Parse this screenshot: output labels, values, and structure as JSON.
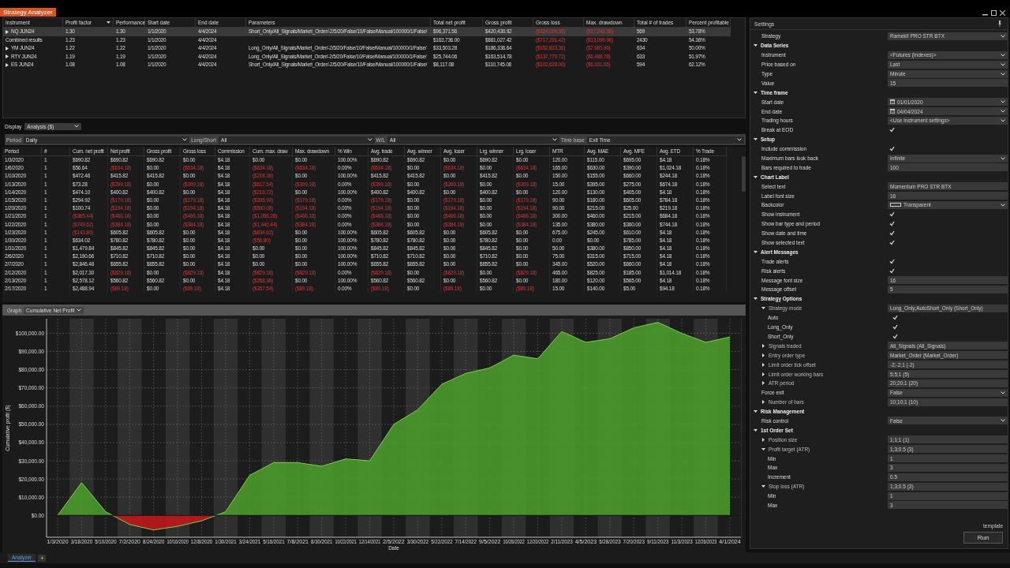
{
  "window": {
    "title": "Strategy Analyzer"
  },
  "summary": {
    "columns": [
      {
        "label": "Instrument"
      },
      {
        "label": "Profit factor",
        "sorted": true
      },
      {
        "label": "Performance"
      },
      {
        "label": "Start date"
      },
      {
        "label": "End date"
      },
      {
        "label": "Parameters"
      },
      {
        "label": "Total net profit"
      },
      {
        "label": "Gross profit"
      },
      {
        "label": "Gross loss"
      },
      {
        "label": "Max. drawdown"
      },
      {
        "label": "Total # of trades"
      },
      {
        "label": "Percent profitable"
      }
    ],
    "rows": [
      {
        "kind": "instrument",
        "selected": true,
        "cells": [
          "NQ JUN24",
          "1.30",
          "1.30",
          "1/1/2020",
          "4/4/2024",
          "Short_Only/All_Signals/Market_Order/-2/5/20/False/10/False/Manual/100000/1/False/",
          "$96,371.56",
          "$420,430.92",
          "($324,059.36)",
          "($17,242.36)",
          "569",
          "53.78%"
        ]
      },
      {
        "kind": "combined",
        "selected": false,
        "cells": [
          "Combined results",
          "1.23",
          "1.23",
          "1/1/2020",
          "4/4/2024",
          "",
          "$163,736.00",
          "$881,027.42",
          "($717,291.42)",
          "($13,096.96)",
          "2430",
          "54.36%"
        ]
      },
      {
        "kind": "instrument",
        "selected": false,
        "cells": [
          "YM JUN24",
          "1.22",
          "1.22",
          "1/1/2020",
          "4/4/2024",
          "Long_Only/All_Signals/Market_Order/-2/5/20/False/10/False/Manual/100000/1/False/",
          "$33,503.28",
          "$186,336.64",
          "($152,833.36)",
          "($7,665.96)",
          "634",
          "50.00%"
        ]
      },
      {
        "kind": "instrument",
        "selected": false,
        "cells": [
          "RTY JUN24",
          "1.19",
          "1.19",
          "1/1/2020",
          "4/4/2024",
          "Long_Only/All_Signals/Market_Order/-2/5/20/False/10/False/Manual/100000/1/False/",
          "$25,744.06",
          "$163,514.78",
          "($137,770.72)",
          "($6,488.78)",
          "633",
          "51.97%"
        ]
      },
      {
        "kind": "instrument",
        "selected": false,
        "cells": [
          "ES JUN24",
          "1.08",
          "1.08",
          "1/1/2020",
          "4/4/2024",
          "Short_Only/All_Signals/Market_Order/-2/5/20/False/10/False/Manual/100000/1/False/",
          "$8,117.08",
          "$110,745.08",
          "($102,628.00)",
          "($6,931.06)",
          "594",
          "62.12%"
        ]
      }
    ]
  },
  "display": {
    "label": "Display",
    "value": "Analysis ($)"
  },
  "filters": [
    {
      "label": "Period",
      "value": "Daily"
    },
    {
      "label": "Long/Short",
      "value": "All"
    },
    {
      "label": "W/L",
      "value": "All"
    },
    {
      "label": "Time base",
      "value": "Exit Time"
    }
  ],
  "periods": {
    "columns": [
      "Period",
      "#",
      "Cum. net profit",
      "Net profit",
      "Gross profit",
      "Gross loss",
      "Commission",
      "Cum. max. draw",
      "Max. drawdown",
      "% Win",
      "Avg. trade",
      "Avg. winner",
      "Avg. loser",
      "Lrg. winner",
      "Lrg. loser",
      "MTR",
      "Avg. MAE",
      "Avg. MFE",
      "Avg. ETD",
      "% Trade"
    ],
    "rows": [
      {
        "kind": "win",
        "cum_negative": false,
        "drawdown_negative": false,
        "cells": [
          "1/3/2020",
          "1",
          "$690.82",
          "$690.82",
          "$690.82",
          "$0.00",
          "$4.18",
          "$0.00",
          "$0.00",
          "100.00%",
          "$690.82",
          "$690.82",
          "$0.00",
          "$690.82",
          "$0.00",
          "120.00",
          "$115.00",
          "$695.00",
          "$4.18",
          "0.18%"
        ]
      },
      {
        "kind": "loss",
        "cum_negative": false,
        "drawdown_negative": true,
        "cells": [
          "1/6/2020",
          "1",
          "$56.64",
          "($634.18)",
          "$0.00",
          "($634.18)",
          "$4.18",
          "($634.18)",
          "($634.18)",
          "0.00%",
          "($634.18)",
          "$0.00",
          "($634.18)",
          "$0.00",
          "($634.18)",
          "165.00",
          "$630.00",
          "$390.00",
          "$1,024.18",
          "0.18%"
        ]
      },
      {
        "kind": "win",
        "cum_negative": false,
        "drawdown_negative": true,
        "cells": [
          "1/10/2020",
          "1",
          "$472.46",
          "$415.82",
          "$415.82",
          "$0.00",
          "$4.18",
          "($218.36)",
          "$0.00",
          "100.00%",
          "$415.82",
          "$415.82",
          "$0.00",
          "$415.82",
          "$0.00",
          "150.00",
          "$155.00",
          "$660.00",
          "$244.18",
          "0.18%"
        ]
      },
      {
        "kind": "loss",
        "cum_negative": false,
        "drawdown_negative": true,
        "cells": [
          "1/13/2020",
          "1",
          "$73.28",
          "($399.18)",
          "$0.00",
          "($399.18)",
          "$4.18",
          "($617.54)",
          "($399.18)",
          "0.00%",
          "($399.18)",
          "$0.00",
          "($399.18)",
          "$0.00",
          "($399.18)",
          "15.00",
          "$395.00",
          "$275.00",
          "$674.18",
          "0.18%"
        ]
      },
      {
        "kind": "win",
        "cum_negative": false,
        "drawdown_negative": true,
        "cells": [
          "1/14/2020",
          "1",
          "$474.10",
          "$400.82",
          "$400.82",
          "$0.00",
          "$4.18",
          "($216.72)",
          "$0.00",
          "100.00%",
          "$400.82",
          "$400.82",
          "$0.00",
          "$400.82",
          "$0.00",
          "120.00",
          "$130.00",
          "$405.00",
          "$4.18",
          "0.18%"
        ]
      },
      {
        "kind": "loss",
        "cum_negative": false,
        "drawdown_negative": true,
        "cells": [
          "1/15/2020",
          "1",
          "$294.92",
          "($179.18)",
          "$0.00",
          "($179.18)",
          "$4.18",
          "($395.90)",
          "($179.18)",
          "0.00%",
          "($179.18)",
          "$0.00",
          "($179.18)",
          "$0.00",
          "($179.18)",
          "90.00",
          "$180.00",
          "$605.00",
          "$784.18",
          "0.18%"
        ]
      },
      {
        "kind": "loss",
        "cum_negative": false,
        "drawdown_negative": true,
        "cells": [
          "1/20/2020",
          "1",
          "$100.74",
          "($194.18)",
          "$0.00",
          "($194.18)",
          "$4.18",
          "($590.08)",
          "($194.18)",
          "0.00%",
          "($194.18)",
          "$0.00",
          "($194.18)",
          "$0.00",
          "($194.18)",
          "90.00",
          "$215.00",
          "$25.00",
          "$219.18",
          "0.18%"
        ]
      },
      {
        "kind": "loss",
        "cum_negative": true,
        "drawdown_negative": true,
        "cells": [
          "1/21/2020",
          "1",
          "($365.44)",
          "($466.18)",
          "$0.00",
          "($466.18)",
          "$4.18",
          "($1,056.26)",
          "($466.18)",
          "0.00%",
          "($466.18)",
          "$0.00",
          "($466.18)",
          "$0.00",
          "($466.18)",
          "300.00",
          "$460.00",
          "$215.00",
          "$684.18",
          "0.18%"
        ]
      },
      {
        "kind": "loss",
        "cum_negative": true,
        "drawdown_negative": true,
        "cells": [
          "1/22/2020",
          "1",
          "($749.62)",
          "($384.18)",
          "$0.00",
          "($384.18)",
          "$4.18",
          "($1,440.44)",
          "($384.18)",
          "0.00%",
          "($384.18)",
          "$0.00",
          "($384.18)",
          "$0.00",
          "($384.18)",
          "135.00",
          "$380.00",
          "$360.00",
          "$744.18",
          "0.18%"
        ]
      },
      {
        "kind": "win",
        "cum_negative": true,
        "drawdown_negative": true,
        "cells": [
          "1/23/2020",
          "1",
          "($143.80)",
          "$605.82",
          "$605.82",
          "$0.00",
          "$4.18",
          "($834.62)",
          "$0.00",
          "100.00%",
          "$605.82",
          "$605.82",
          "$0.00",
          "$605.82",
          "$0.00",
          "675.00",
          "$245.00",
          "$610.00",
          "$4.18",
          "0.18%"
        ]
      },
      {
        "kind": "win",
        "cum_negative": false,
        "drawdown_negative": true,
        "cells": [
          "1/30/2020",
          "1",
          "$634.02",
          "$780.82",
          "$780.82",
          "$0.00",
          "$4.18",
          "($56.80)",
          "$0.00",
          "100.00%",
          "$780.82",
          "$780.82",
          "$0.00",
          "$780.82",
          "$0.00",
          "0.00",
          "$0.00",
          "$785.00",
          "$4.18",
          "0.18%"
        ]
      },
      {
        "kind": "win",
        "cum_negative": false,
        "drawdown_negative": false,
        "cells": [
          "1/31/2020",
          "1",
          "$1,479.84",
          "$845.82",
          "$845.82",
          "$0.00",
          "$4.18",
          "$0.00",
          "$0.00",
          "100.00%",
          "$845.82",
          "$845.82",
          "$0.00",
          "$845.82",
          "$0.00",
          "50.00",
          "$380.00",
          "$850.00",
          "$4.18",
          "0.18%"
        ]
      },
      {
        "kind": "win",
        "cum_negative": false,
        "drawdown_negative": false,
        "cells": [
          "2/6/2020",
          "1",
          "$2,190.66",
          "$710.82",
          "$710.82",
          "$0.00",
          "$4.18",
          "$0.00",
          "$0.00",
          "100.00%",
          "$710.82",
          "$710.82",
          "$0.00",
          "$710.82",
          "$0.00",
          "75.00",
          "$315.00",
          "$715.00",
          "$4.18",
          "0.18%"
        ]
      },
      {
        "kind": "win",
        "cum_negative": false,
        "drawdown_negative": false,
        "cells": [
          "2/7/2020",
          "1",
          "$2,846.48",
          "$655.82",
          "$655.82",
          "$0.00",
          "$4.18",
          "$0.00",
          "$0.00",
          "100.00%",
          "$655.82",
          "$655.82",
          "$0.00",
          "$655.82",
          "$0.00",
          "345.00",
          "$520.00",
          "$660.00",
          "$4.18",
          "0.18%"
        ]
      },
      {
        "kind": "loss",
        "cum_negative": false,
        "drawdown_negative": true,
        "cells": [
          "2/12/2020",
          "1",
          "$2,017.30",
          "($829.18)",
          "$0.00",
          "($829.18)",
          "$4.18",
          "($829.18)",
          "($829.18)",
          "0.00%",
          "($829.18)",
          "$0.00",
          "($829.18)",
          "$0.00",
          "($829.18)",
          "465.00",
          "$825.00",
          "$185.00",
          "$1,014.18",
          "0.18%"
        ]
      },
      {
        "kind": "win",
        "cum_negative": false,
        "drawdown_negative": true,
        "cells": [
          "2/13/2020",
          "1",
          "$2,578.12",
          "$560.82",
          "$560.82",
          "$0.00",
          "$4.18",
          "($268.36)",
          "$0.00",
          "100.00%",
          "$560.82",
          "$560.82",
          "$0.00",
          "$560.82",
          "$0.00",
          "180.00",
          "$120.00",
          "$565.00",
          "$4.18",
          "0.18%"
        ]
      },
      {
        "kind": "loss",
        "cum_negative": false,
        "drawdown_negative": true,
        "cells": [
          "2/17/2020",
          "1",
          "$2,488.94",
          "($89.18)",
          "$0.00",
          "($89.18)",
          "$4.18",
          "($357.54)",
          "($89.18)",
          "0.00%",
          "($89.18)",
          "$0.00",
          "($89.18)",
          "$0.00",
          "($89.18)",
          "15.00",
          "$140.00",
          "$5.00",
          "$94.18",
          "0.18%"
        ]
      }
    ]
  },
  "graph": {
    "label": "Graph",
    "value": "Cumulative Net Profit",
    "chart_data": {
      "type": "area",
      "xlabel": "Date",
      "ylabel": "Cumulative profit ($)",
      "grid": true,
      "categories": [
        "1/3/2020",
        "3/18/2020",
        "5/10/2020",
        "7/2/2020",
        "8/24/2020",
        "10/16/2020",
        "12/8/2020",
        "1/30/2021",
        "3/24/2021",
        "5/16/2021",
        "7/8/2021",
        "8/30/2021",
        "10/22/2021",
        "12/14/2021",
        "2/5/2022",
        "3/30/2022",
        "5/22/2022",
        "7/14/2022",
        "9/5/2022",
        "10/28/2022",
        "12/20/2022",
        "2/11/2023",
        "4/5/2023",
        "5/28/2023",
        "7/20/2023",
        "9/11/2023",
        "11/3/2023",
        "12/26/2023",
        "4/1/2024"
      ],
      "series": [
        {
          "color": "#4a9a2a",
          "values": [
            0,
            18000,
            2000,
            -5000,
            -8000,
            -6000,
            -3000,
            2000,
            22000,
            29000,
            29000,
            27000,
            31000,
            30000,
            50000,
            58000,
            72000,
            78000,
            81000,
            88000,
            86000,
            101000,
            95000,
            97000,
            103000,
            106000,
            100000,
            95000,
            98000
          ]
        }
      ],
      "ylim": [
        -12000,
        108000
      ],
      "yticks": [
        {
          "value": 0,
          "label": "$0.00"
        },
        {
          "value": 10000,
          "label": "$10,000.00"
        },
        {
          "value": 20000,
          "label": "$20,000.00"
        },
        {
          "value": 30000,
          "label": "$30,000.00"
        },
        {
          "value": 40000,
          "label": "$40,000.00"
        },
        {
          "value": 50000,
          "label": "$50,000.00"
        },
        {
          "value": 60000,
          "label": "$60,000.00"
        },
        {
          "value": 70000,
          "label": "$70,000.00"
        },
        {
          "value": 80000,
          "label": "$80,000.00"
        },
        {
          "value": 90000,
          "label": "$90,000.00"
        },
        {
          "value": 100000,
          "label": "$100,000.00"
        }
      ]
    }
  },
  "settings": {
    "title": "Settings",
    "items": [
      {
        "label": "Strategy",
        "kind": "select",
        "value": "Rameki! PRO STR BTX"
      },
      {
        "label": "Data Series",
        "kind": "section",
        "expanded": true,
        "children": [
          {
            "label": "Instrument",
            "kind": "select",
            "value": "<Futures (Indexes)>"
          },
          {
            "label": "Price based on",
            "kind": "select",
            "value": "Last"
          },
          {
            "label": "Type",
            "kind": "select",
            "value": "Minute"
          },
          {
            "label": "Value",
            "kind": "input",
            "value": "15"
          }
        ]
      },
      {
        "label": "Time frame",
        "kind": "section",
        "expanded": true,
        "children": [
          {
            "label": "Start date",
            "kind": "date",
            "value": "01/01/2020"
          },
          {
            "label": "End date",
            "kind": "date",
            "value": "04/04/2024"
          },
          {
            "label": "Trading hours",
            "kind": "select",
            "value": "<Use instrument settings>"
          },
          {
            "label": "Break at EOD",
            "kind": "check",
            "checked": true
          }
        ]
      },
      {
        "label": "Setup",
        "kind": "section",
        "expanded": true,
        "children": [
          {
            "label": "Include commission",
            "kind": "check",
            "checked": true
          },
          {
            "label": "Maximum bars look back",
            "kind": "select",
            "value": "Infinite"
          },
          {
            "label": "Bars required to trade",
            "kind": "input",
            "value": "100"
          }
        ]
      },
      {
        "label": "Chart Label",
        "kind": "section",
        "expanded": true,
        "children": [
          {
            "label": "Select text",
            "kind": "input",
            "value": "Momentum PRO STR BTX"
          },
          {
            "label": "Label font size",
            "kind": "input",
            "value": "16"
          },
          {
            "label": "Backcolor",
            "kind": "color",
            "value": "Transparent"
          },
          {
            "label": "Show instrument",
            "kind": "check",
            "checked": true
          },
          {
            "label": "Show bar type and period",
            "kind": "check",
            "checked": true
          },
          {
            "label": "Show date and time",
            "kind": "check",
            "checked": true
          },
          {
            "label": "Show selected text",
            "kind": "check",
            "checked": true
          }
        ]
      },
      {
        "label": "Alert Messages",
        "kind": "section",
        "expanded": true,
        "children": [
          {
            "label": "Trade alerts",
            "kind": "check",
            "checked": true
          },
          {
            "label": "Risk alerts",
            "kind": "check",
            "checked": true
          },
          {
            "label": "Message font size",
            "kind": "input",
            "value": "16"
          },
          {
            "label": "Message offset",
            "kind": "input",
            "value": "5"
          }
        ]
      },
      {
        "label": "Strategy Options",
        "kind": "section",
        "expanded": true,
        "children": [
          {
            "label": "Strategy mode",
            "kind": "input",
            "value": "Long_Only;AutoShort_Only (Short_Only)",
            "expanded": true,
            "children": [
              {
                "label": "Auto",
                "kind": "check",
                "checked": true
              },
              {
                "label": "Long_Only",
                "kind": "check",
                "checked": true
              },
              {
                "label": "Short_Only",
                "kind": "check",
                "checked": true
              }
            ]
          },
          {
            "label": "Signals traded",
            "kind": "input",
            "value": "All_Signals (All_Signals)",
            "expanded": false
          },
          {
            "label": "Entry order type",
            "kind": "input",
            "value": "Market_Order (Market_Order)",
            "expanded": false
          },
          {
            "label": "Limit order tick offset",
            "kind": "input",
            "value": "-2;-2;1 (-2)",
            "expanded": false
          },
          {
            "label": "Limit order working bars",
            "kind": "input",
            "value": "5;5;1 (5)",
            "expanded": false
          },
          {
            "label": "ATR period",
            "kind": "input",
            "value": "20;20;1 (20)",
            "expanded": false
          },
          {
            "label": "Force exit",
            "kind": "select",
            "value": "False"
          },
          {
            "label": "Number of bars",
            "kind": "input",
            "value": "10;10;1 (10)",
            "expanded": false
          }
        ]
      },
      {
        "label": "Risk Management",
        "kind": "section",
        "expanded": true,
        "children": [
          {
            "label": "Risk control",
            "kind": "select",
            "value": "False"
          }
        ]
      },
      {
        "label": "1st Order Set",
        "kind": "section",
        "expanded": true,
        "children": [
          {
            "label": "Position size",
            "kind": "input",
            "value": "1;1;1 (1)",
            "expanded": false
          },
          {
            "label": "Profit target (ATR)",
            "kind": "input",
            "value": "1;3;0.5 (3)",
            "expanded": true,
            "children": [
              {
                "label": "Min",
                "kind": "input",
                "value": "1"
              },
              {
                "label": "Max",
                "kind": "input",
                "value": "3"
              },
              {
                "label": "Increment",
                "kind": "input",
                "value": "0.5"
              }
            ]
          },
          {
            "label": "Stop loss (ATR)",
            "kind": "input",
            "value": "1;3;0.5 (3)",
            "expanded": true,
            "children": [
              {
                "label": "Min",
                "kind": "input",
                "value": "1"
              },
              {
                "label": "Max",
                "kind": "input",
                "value": "3"
              }
            ]
          }
        ]
      }
    ],
    "template_link": "template",
    "run_button": "Run"
  },
  "tabs": [
    {
      "label": "Analyzer",
      "selected": true
    }
  ],
  "add_tab": "+"
}
